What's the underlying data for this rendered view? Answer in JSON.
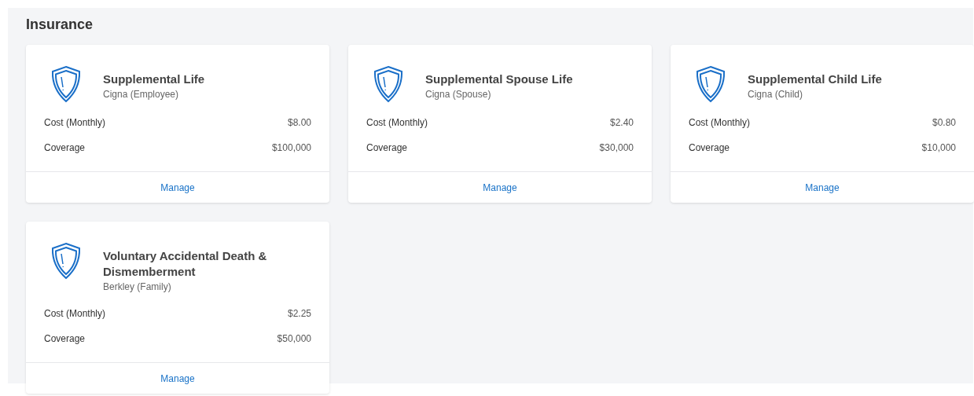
{
  "section": {
    "title": "Insurance"
  },
  "cards": [
    {
      "title": "Supplemental Life",
      "provider": "Cigna (Employee)",
      "rows": [
        {
          "label": "Cost (Monthly)",
          "value": "$8.00"
        },
        {
          "label": "Coverage",
          "value": "$100,000"
        }
      ],
      "action": "Manage"
    },
    {
      "title": "Supplemental Spouse Life",
      "provider": "Cigna (Spouse)",
      "rows": [
        {
          "label": "Cost (Monthly)",
          "value": "$2.40"
        },
        {
          "label": "Coverage",
          "value": "$30,000"
        }
      ],
      "action": "Manage"
    },
    {
      "title": "Supplemental Child Life",
      "provider": "Cigna (Child)",
      "rows": [
        {
          "label": "Cost (Monthly)",
          "value": "$0.80"
        },
        {
          "label": "Coverage",
          "value": "$10,000"
        }
      ],
      "action": "Manage"
    },
    {
      "title": "Voluntary Accidental Death & Dismemberment",
      "provider": "Berkley (Family)",
      "rows": [
        {
          "label": "Cost (Monthly)",
          "value": "$2.25"
        },
        {
          "label": "Coverage",
          "value": "$50,000"
        }
      ],
      "action": "Manage"
    }
  ]
}
